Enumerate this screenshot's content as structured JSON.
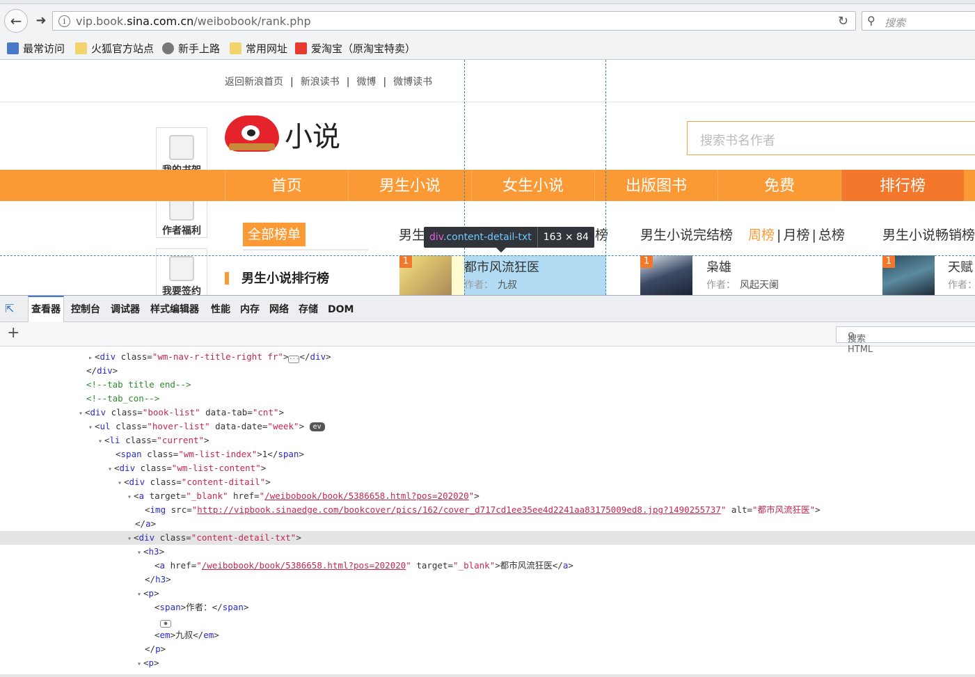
{
  "browser": {
    "url_prefix": "vip.book.",
    "url_domain": "sina.com.cn",
    "url_path": "/weibobook/rank.php",
    "search_placeholder": "搜索",
    "bookmarks": [
      "最常访问",
      "火狐官方站点",
      "新手上路",
      "常用网址",
      "爱淘宝（原淘宝特卖）"
    ]
  },
  "page": {
    "toplinks": [
      "返回新浪首页",
      "新浪读书",
      "微博",
      "微博读书"
    ],
    "logo_text": "小说",
    "side": [
      "我的书架",
      "作者福利",
      "我要签约"
    ],
    "search_placeholder": "搜索书名作者",
    "nav": [
      "首页",
      "男生小说",
      "女生小说",
      "出版图书",
      "免费",
      "排行榜"
    ],
    "rank_all": "全部榜单",
    "rank_sub": "男生小说排行榜",
    "col1_prefix": "男生",
    "col1_suffix": "总榜",
    "col2_title": "男生小说完结榜",
    "col2_tabs": [
      "周榜",
      "月榜",
      "总榜"
    ],
    "col3_title": "男生小说畅销榜",
    "books": [
      {
        "num": "1",
        "title": "都市风流狂医",
        "author_label": "作者：",
        "author": "九叔"
      },
      {
        "num": "1",
        "title": "枭雄",
        "author_label": "作者：",
        "author": "风起天阑"
      },
      {
        "num": "1",
        "title": "天赋",
        "author_label": "作者：",
        "author": ""
      }
    ],
    "tooltip_tag": "div",
    "tooltip_class": ".content-detail-txt",
    "tooltip_size": "163 × 84"
  },
  "devtools": {
    "tabs": [
      "查看器",
      "控制台",
      "调试器",
      "样式编辑器",
      "性能",
      "内存",
      "网络",
      "存储",
      "DOM"
    ],
    "search_placeholder": "搜索 HTML",
    "lines": {
      "l0_cls": "wm-nav-r-title-right fr",
      "l2": "<!--tab title end-->",
      "l3": "<!--tab_con-->",
      "l4_cls": "book-list",
      "l4_tab": "cnt",
      "l5_cls": "hover-list",
      "l5_date": "week",
      "l5_badge": "ev",
      "l6_cls": "current",
      "l7_cls": "wm-list-index",
      "l7_txt": "1",
      "l8_cls": "wm-list-content",
      "l9_cls": "content-ditail",
      "l10_target": "_blank",
      "l10_href": "/weibobook/book/5386658.html?pos=202020",
      "l11_src": "http://vipbook.sinaedge.com/bookcover/pics/162/cover_d717cd1ee35ee4d2241aa83175009ed8.jpg?1490255737",
      "l11_alt": "都市风流狂医",
      "l13_cls": "content-detail-txt",
      "l15_href": "/weibobook/book/5386658.html?pos=202020",
      "l15_target": "_blank",
      "l15_txt": "都市风流狂医",
      "l18_txt": "作者：",
      "l20_txt": "九叔"
    }
  },
  "colors": {
    "orange": "#fb9a35",
    "orange_dark": "#f4782b",
    "highlight": "#87c8eb"
  }
}
